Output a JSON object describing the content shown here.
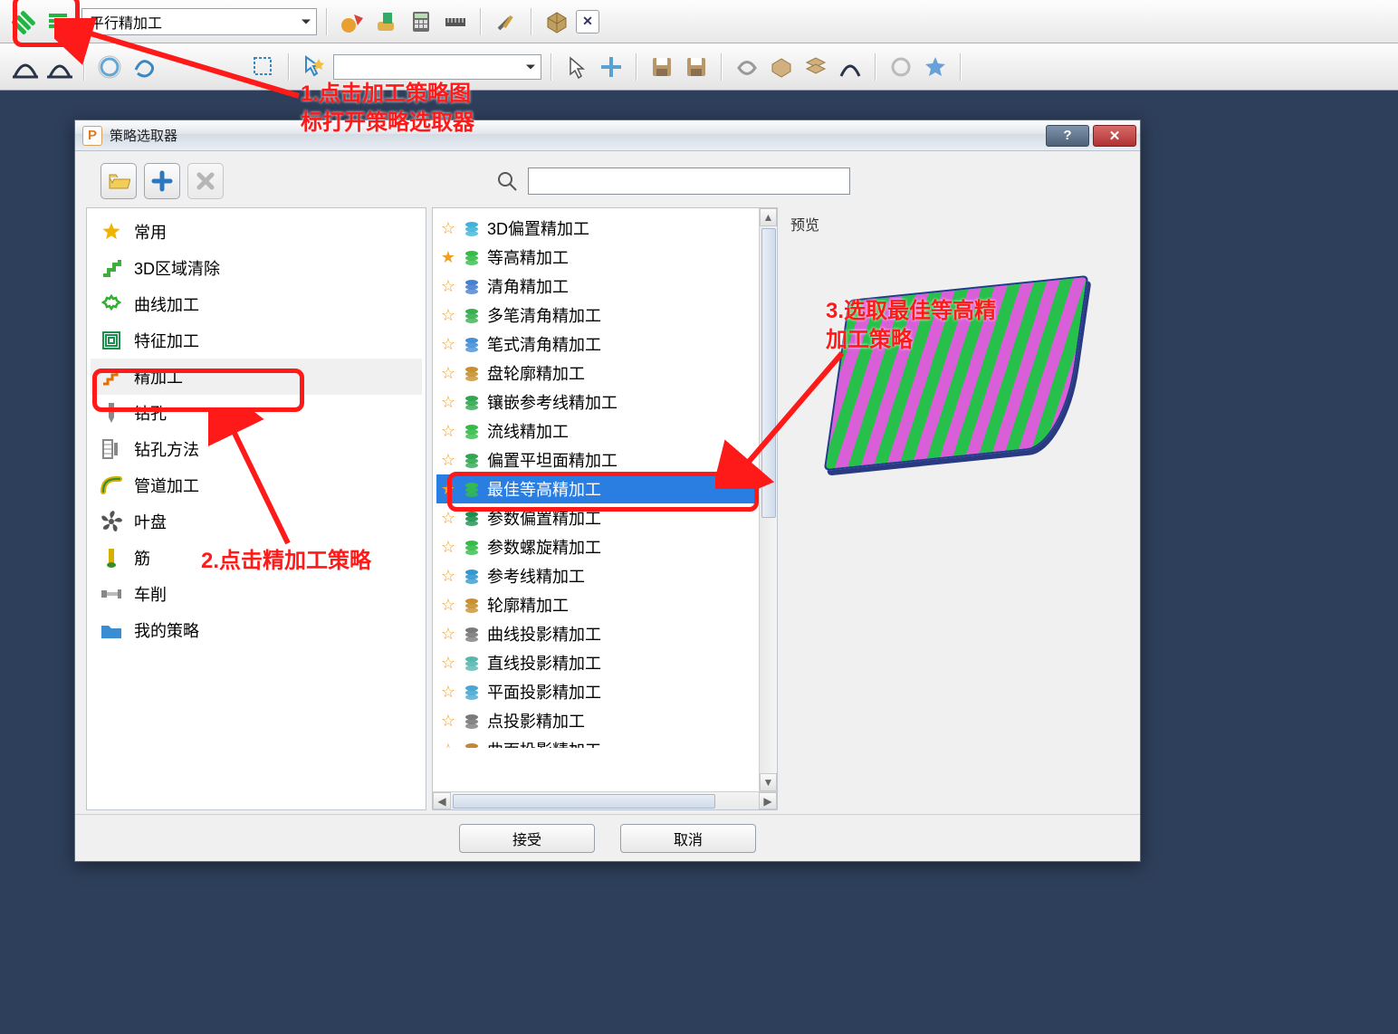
{
  "toolbar": {
    "strategy_combo_value": "平行精加工"
  },
  "dialog": {
    "title": "策略选取器",
    "help_btn": "?",
    "close_btn": "✕",
    "search_placeholder": "",
    "accept": "接受",
    "cancel": "取消",
    "preview_label": "预览"
  },
  "categories": [
    {
      "label": "常用",
      "icon": "star",
      "color": "#f0b400"
    },
    {
      "label": "3D区域清除",
      "icon": "steps",
      "color": "#3fae3f"
    },
    {
      "label": "曲线加工",
      "icon": "gear",
      "color": "#2fae2f"
    },
    {
      "label": "特征加工",
      "icon": "spiral",
      "color": "#1b8f4d"
    },
    {
      "label": "精加工",
      "icon": "fin-steps",
      "color": "#e07000",
      "selected": true
    },
    {
      "label": "钻孔",
      "icon": "drill",
      "color": "#888888"
    },
    {
      "label": "钻孔方法",
      "icon": "drill2",
      "color": "#888888"
    },
    {
      "label": "管道加工",
      "icon": "pipe",
      "color": "#d4b000"
    },
    {
      "label": "叶盘",
      "icon": "fan",
      "color": "#555555"
    },
    {
      "label": "筋",
      "icon": "rib",
      "color": "#d4b000"
    },
    {
      "label": "车削",
      "icon": "lathe",
      "color": "#888888"
    },
    {
      "label": "我的策略",
      "icon": "folder",
      "color": "#3a8dd0"
    }
  ],
  "strategies": [
    {
      "label": "3D偏置精加工",
      "fav": false,
      "icon_color": "#40b4d8"
    },
    {
      "label": "等高精加工",
      "fav": true,
      "icon_color": "#34bc4a"
    },
    {
      "label": "清角精加工",
      "fav": false,
      "icon_color": "#4680d0"
    },
    {
      "label": "多笔清角精加工",
      "fav": false,
      "icon_color": "#38b050"
    },
    {
      "label": "笔式清角精加工",
      "fav": false,
      "icon_color": "#4690d8"
    },
    {
      "label": "盘轮廓精加工",
      "fav": false,
      "icon_color": "#c89030"
    },
    {
      "label": "镶嵌参考线精加工",
      "fav": false,
      "icon_color": "#30a850"
    },
    {
      "label": "流线精加工",
      "fav": false,
      "icon_color": "#34bc4a"
    },
    {
      "label": "偏置平坦面精加工",
      "fav": false,
      "icon_color": "#30a850"
    },
    {
      "label": "最佳等高精加工",
      "fav": true,
      "icon_color": "#34bc4a",
      "selected": true
    },
    {
      "label": "参数偏置精加工",
      "fav": false,
      "icon_color": "#1b8f4d"
    },
    {
      "label": "参数螺旋精加工",
      "fav": false,
      "icon_color": "#34bc4a"
    },
    {
      "label": "参考线精加工",
      "fav": false,
      "icon_color": "#3498d0"
    },
    {
      "label": "轮廓精加工",
      "fav": false,
      "icon_color": "#c89030"
    },
    {
      "label": "曲线投影精加工",
      "fav": false,
      "icon_color": "#7a7a7a"
    },
    {
      "label": "直线投影精加工",
      "fav": false,
      "icon_color": "#58b8b0"
    },
    {
      "label": "平面投影精加工",
      "fav": false,
      "icon_color": "#48a8d0"
    },
    {
      "label": "点投影精加工",
      "fav": false,
      "icon_color": "#7a7a7a"
    },
    {
      "label": "曲面投影精加工",
      "fav": false,
      "icon_color": "#c08838"
    }
  ],
  "annotations": {
    "step1": "1.点击加工策略图\n标打开策略选取器",
    "step2": "2.点击精加工策略",
    "step3": "3.选取最佳等高精\n加工策略"
  }
}
